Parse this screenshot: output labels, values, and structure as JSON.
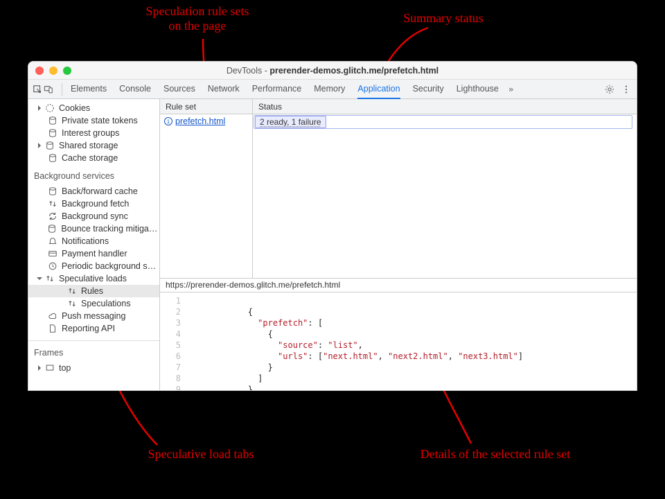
{
  "window": {
    "title_prefix": "DevTools - ",
    "title_bold": "prerender-demos.glitch.me/prefetch.html"
  },
  "tabbar": {
    "tabs": [
      "Elements",
      "Console",
      "Sources",
      "Network",
      "Performance",
      "Memory",
      "Application",
      "Security",
      "Lighthouse"
    ],
    "selected": "Application",
    "more": "»"
  },
  "sidebar": {
    "top_items": [
      {
        "icon": "cookie",
        "label": "Cookies",
        "expandable": true
      },
      {
        "icon": "db",
        "label": "Private state tokens"
      },
      {
        "icon": "db",
        "label": "Interest groups"
      },
      {
        "icon": "db",
        "label": "Shared storage",
        "expandable": true
      },
      {
        "icon": "db",
        "label": "Cache storage"
      }
    ],
    "bg_caption": "Background services",
    "bg_items": [
      {
        "icon": "db",
        "label": "Back/forward cache"
      },
      {
        "icon": "updown",
        "label": "Background fetch"
      },
      {
        "icon": "sync",
        "label": "Background sync"
      },
      {
        "icon": "db",
        "label": "Bounce tracking mitigations"
      },
      {
        "icon": "bell",
        "label": "Notifications"
      },
      {
        "icon": "card",
        "label": "Payment handler"
      },
      {
        "icon": "clock",
        "label": "Periodic background sync"
      },
      {
        "icon": "updown",
        "label": "Speculative loads",
        "expandable": true,
        "open": true
      },
      {
        "icon": "updown",
        "label": "Rules",
        "depth": 2,
        "selected": true
      },
      {
        "icon": "updown",
        "label": "Speculations",
        "depth": 2
      },
      {
        "icon": "cloud",
        "label": "Push messaging"
      },
      {
        "icon": "doc",
        "label": "Reporting API"
      }
    ],
    "frames_caption": "Frames",
    "frames_items": [
      {
        "icon": "frame",
        "label": "top",
        "expandable": true
      }
    ]
  },
  "grid": {
    "col1": "Rule set",
    "col2": "Status",
    "ruleset": "prefetch.html",
    "status": "2 ready, 1 failure"
  },
  "details": {
    "path": "https://prerender-demos.glitch.me/prefetch.html"
  },
  "code_lines": [
    "",
    "{",
    "  \"prefetch\": [",
    "    {",
    "      \"source\": \"list\",",
    "      \"urls\": [\"next.html\", \"next2.html\", \"next3.html\"]",
    "    }",
    "  ]",
    "}"
  ],
  "annotations": {
    "rulesets": "Speculation rule sets\non the page",
    "summary": "Summary status",
    "tabs": "Speculative load tabs",
    "details": "Details of the selected rule set"
  }
}
